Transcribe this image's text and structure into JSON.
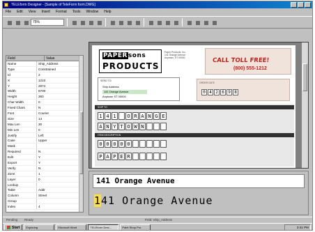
{
  "window": {
    "title": "TELEform Designer - [Sample of TeleForm form.DWG]"
  },
  "menu": [
    "File",
    "Edit",
    "View",
    "Insert",
    "Format",
    "Tools",
    "Window",
    "Help"
  ],
  "toolbar": {
    "zoom_value": "75%"
  },
  "properties": {
    "columns": [
      "Field",
      "Value"
    ],
    "rows": [
      {
        "k": "Name",
        "v": "Ship_Address"
      },
      {
        "k": "Type",
        "v": "Constrained"
      },
      {
        "k": "Id",
        "v": "2"
      },
      {
        "k": "X",
        "v": "1210"
      },
      {
        "k": "Y",
        "v": "2874"
      },
      {
        "k": "Width",
        "v": "8700"
      },
      {
        "k": "Height",
        "v": "360"
      },
      {
        "k": "Char Width",
        "v": "0"
      },
      {
        "k": "Fixed Chars",
        "v": "N"
      },
      {
        "k": "Font",
        "v": "Courier"
      },
      {
        "k": "Size",
        "v": "14"
      },
      {
        "k": "Max Len",
        "v": "30"
      },
      {
        "k": "Min Len",
        "v": "0"
      },
      {
        "k": "Justify",
        "v": "Left"
      },
      {
        "k": "Case",
        "v": "Upper"
      },
      {
        "k": "Mask",
        "v": ""
      },
      {
        "k": "Required",
        "v": "N"
      },
      {
        "k": "Edit",
        "v": "Y"
      },
      {
        "k": "Export",
        "v": "Y"
      },
      {
        "k": "Verify",
        "v": "N"
      },
      {
        "k": "Zone",
        "v": "1"
      },
      {
        "k": "Layer",
        "v": "0"
      },
      {
        "k": "Lookup",
        "v": ""
      },
      {
        "k": "Table",
        "v": "Addr"
      },
      {
        "k": "Column",
        "v": "Street"
      },
      {
        "k": "Group",
        "v": ""
      },
      {
        "k": "Index",
        "v": "4"
      }
    ]
  },
  "form": {
    "logo_top": "PAPER",
    "logo_top_rest": "sons",
    "logo_bottom": "PRODUCTS",
    "address_lines": [
      "Paper Products, Inc.",
      "141 Orange Avenue",
      "Anytown, ST 00000"
    ],
    "call_label": "CALL TOLL FREE!",
    "phone": "(800) 555-1212",
    "send_label": "SEND TO:",
    "send_lines": [
      "Ship Address",
      "141 Orange Avenue",
      "Anytown          ST   00000"
    ],
    "info_label": "ORDER DATE",
    "info_cells": [
      "0",
      "4",
      "2",
      "6",
      "9",
      "8"
    ],
    "band1": "SHIP TO",
    "band2": "ITEM DESCRIPTION",
    "row1": [
      "1",
      "4",
      "1",
      "",
      "O",
      "R",
      "A",
      "N",
      "G",
      "E"
    ],
    "row2": [
      "A",
      "N",
      "Y",
      "T",
      "O",
      "W",
      "N",
      "",
      "",
      ""
    ],
    "row3": [
      "0",
      "0",
      "0",
      "0",
      "0",
      "",
      "",
      "",
      "",
      ""
    ],
    "row4": [
      "P",
      "A",
      "P",
      "E",
      "R",
      "",
      "",
      "",
      "",
      ""
    ]
  },
  "preview": {
    "line1": "141 Orange Avenue",
    "line2_first": "1",
    "line2_rest": "41 Orange Avenue"
  },
  "status": {
    "left": "Pending",
    "left2": "Ready",
    "mid": "Field: Ship_Address"
  },
  "taskbar": {
    "start": "Start",
    "tasks": [
      "Exploring",
      "Microsoft Word",
      "TELEform Desi...",
      "Paint Shop Pro"
    ],
    "clock": "3:41 PM"
  },
  "colors": {
    "titlebar": "#000080",
    "accent_red": "#c0201a",
    "highlight": "#c8e8c8"
  }
}
